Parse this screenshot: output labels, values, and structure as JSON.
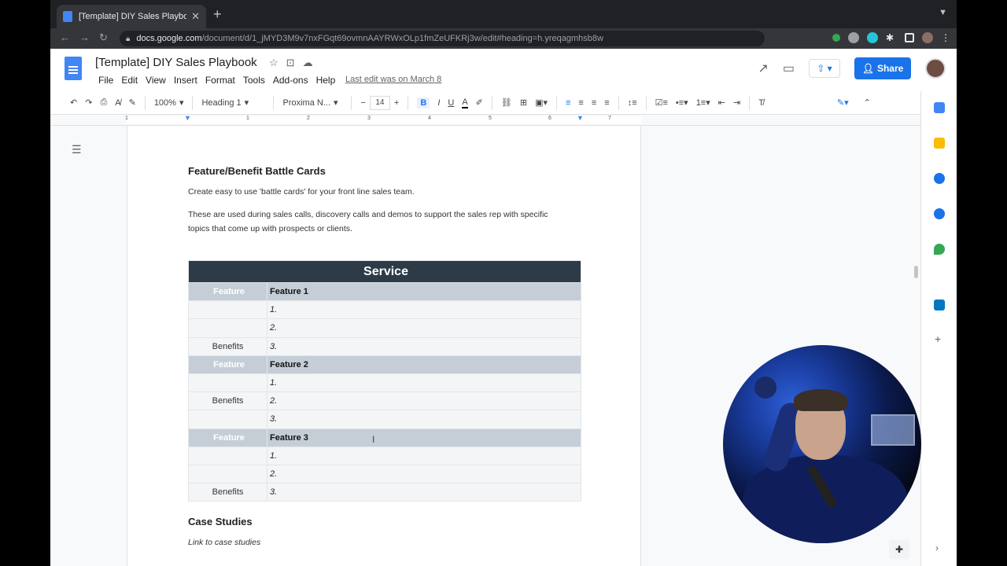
{
  "browser": {
    "tab_title": "[Template] DIY Sales Playbook",
    "tab_close": "✕",
    "new_tab": "+",
    "url_domain": "docs.google.com",
    "url_path": "/document/d/1_jMYD3M9v7nxFGqt69ovmnAAYRWxOLp1fmZeUFKRj3w/edit#heading=h.yreqagmhsb8w"
  },
  "doc": {
    "title": "[Template] DIY Sales Playbook",
    "menu": [
      "File",
      "Edit",
      "View",
      "Insert",
      "Format",
      "Tools",
      "Add-ons",
      "Help"
    ],
    "last_edit": "Last edit was on March 8",
    "share_label": "Share"
  },
  "toolbar": {
    "zoom": "100%",
    "style": "Heading 1",
    "font": "Proxima N...",
    "font_size": "14",
    "bold": "B",
    "italic": "I",
    "underline": "U",
    "text_color": "A"
  },
  "ruler": [
    "1",
    "1",
    "2",
    "3",
    "4",
    "5",
    "6",
    "7"
  ],
  "content": {
    "heading1": "Feature/Benefit Battle Cards",
    "para1": "Create easy to use 'battle cards' for your front line sales team.",
    "para2": "These are used during sales calls, discovery calls and demos to support the sales rep with specific topics that come up with prospects or clients.",
    "table": {
      "header": "Service",
      "feature_label": "Feature",
      "benefits_label": "Benefits",
      "features": [
        {
          "name": "Feature 1",
          "benefits": [
            "1.",
            "2.",
            "3."
          ]
        },
        {
          "name": "Feature 2",
          "benefits": [
            "1.",
            "2.",
            "3."
          ]
        },
        {
          "name": "Feature 3",
          "benefits": [
            "1.",
            "2.",
            "3."
          ]
        }
      ]
    },
    "heading2": "Case Studies",
    "para3": "Link to case studies"
  }
}
